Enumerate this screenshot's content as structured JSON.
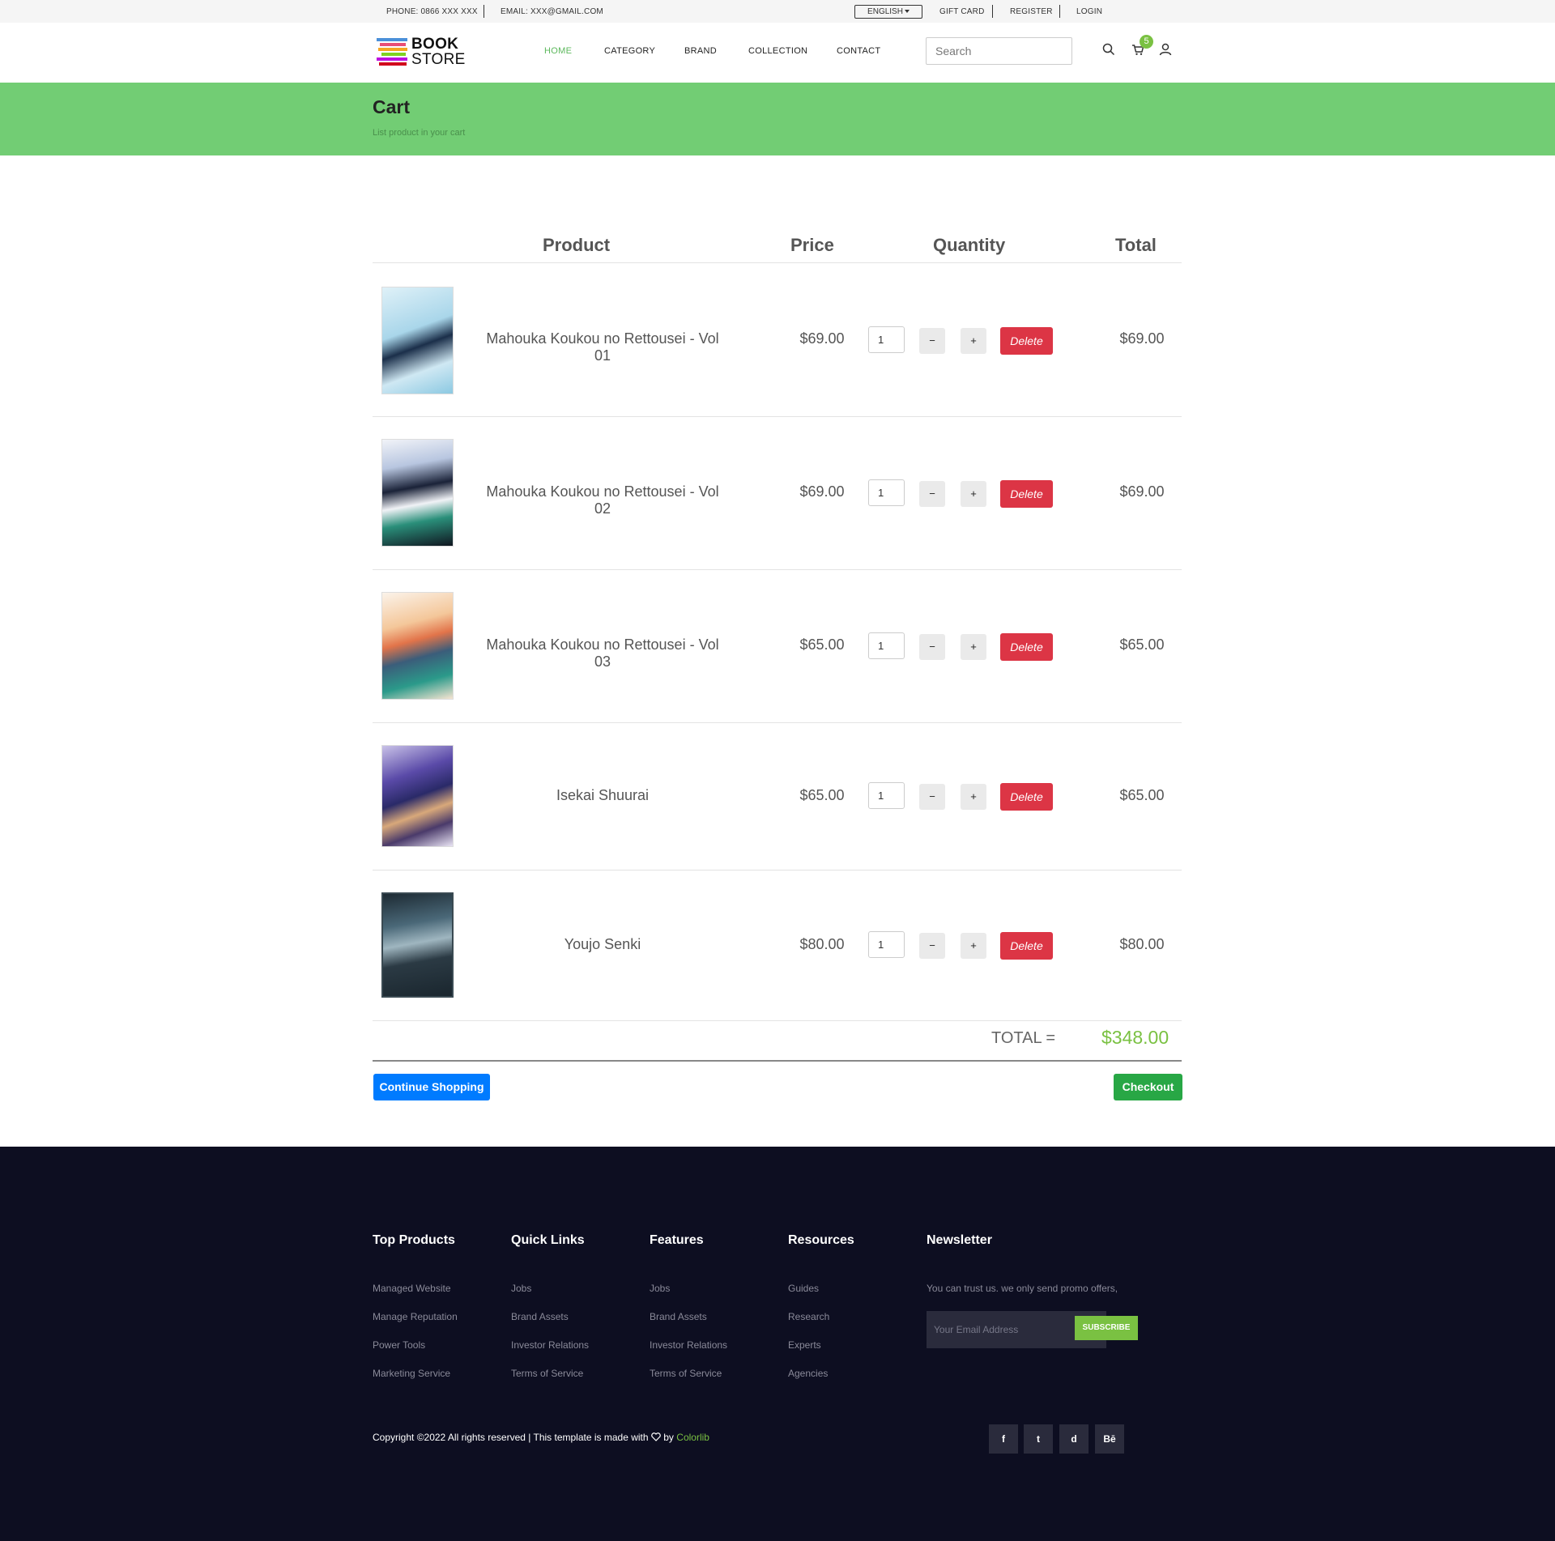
{
  "topbar": {
    "phone": "PHONE: 0866 XXX XXX",
    "email": "EMAIL: XXX@GMAIL.COM",
    "language": "ENGLISH",
    "gift_card": "GIFT CARD",
    "register": "REGISTER",
    "login": "LOGIN"
  },
  "header": {
    "logo_line1": "BOOK",
    "logo_line2": "STORE",
    "nav": [
      "HOME",
      "CATEGORY",
      "BRAND",
      "COLLECTION",
      "CONTACT"
    ],
    "active_nav": "HOME",
    "search_placeholder": "Search",
    "cart_count": "5"
  },
  "banner": {
    "title": "Cart",
    "subtitle": "List product in your cart"
  },
  "cart": {
    "columns": {
      "product": "Product",
      "price": "Price",
      "quantity": "Quantity",
      "total": "Total"
    },
    "delete_label": "Delete",
    "minus_label": "−",
    "plus_label": "+",
    "items": [
      {
        "name": "Mahouka Koukou no Rettousei - Vol 01",
        "price": "$69.00",
        "qty": "1",
        "total": "$69.00"
      },
      {
        "name": "Mahouka Koukou no Rettousei - Vol 02",
        "price": "$69.00",
        "qty": "1",
        "total": "$69.00"
      },
      {
        "name": "Mahouka Koukou no Rettousei - Vol 03",
        "price": "$65.00",
        "qty": "1",
        "total": "$65.00"
      },
      {
        "name": "Isekai Shuurai",
        "price": "$65.00",
        "qty": "1",
        "total": "$65.00"
      },
      {
        "name": "Youjo Senki",
        "price": "$80.00",
        "qty": "1",
        "total": "$80.00"
      }
    ],
    "total_label": "TOTAL =",
    "total_value": "$348.00",
    "continue_label": "Continue Shopping",
    "checkout_label": "Checkout"
  },
  "footer": {
    "columns": [
      {
        "title": "Top Products",
        "links": [
          "Managed Website",
          "Manage Reputation",
          "Power Tools",
          "Marketing Service"
        ]
      },
      {
        "title": "Quick Links",
        "links": [
          "Jobs",
          "Brand Assets",
          "Investor Relations",
          "Terms of Service"
        ]
      },
      {
        "title": "Features",
        "links": [
          "Jobs",
          "Brand Assets",
          "Investor Relations",
          "Terms of Service"
        ]
      },
      {
        "title": "Resources",
        "links": [
          "Guides",
          "Research",
          "Experts",
          "Agencies"
        ]
      }
    ],
    "newsletter": {
      "title": "Newsletter",
      "text": "You can trust us. we only send promo offers,",
      "placeholder": "Your Email Address",
      "button": "SUBSCRIBE"
    },
    "copyright": "Copyright ©2022 All rights reserved | This template is made with",
    "copyright_by": "by",
    "copyright_brand": "Colorlib",
    "social": [
      "f",
      "t",
      "d",
      "Bē"
    ]
  },
  "colors": {
    "accent_green": "#7ac142",
    "banner_green": "#72cd74",
    "delete_red": "#dc3545",
    "primary_blue": "#007bff",
    "checkout_green": "#28a745",
    "footer_bg": "#0d0e21"
  }
}
